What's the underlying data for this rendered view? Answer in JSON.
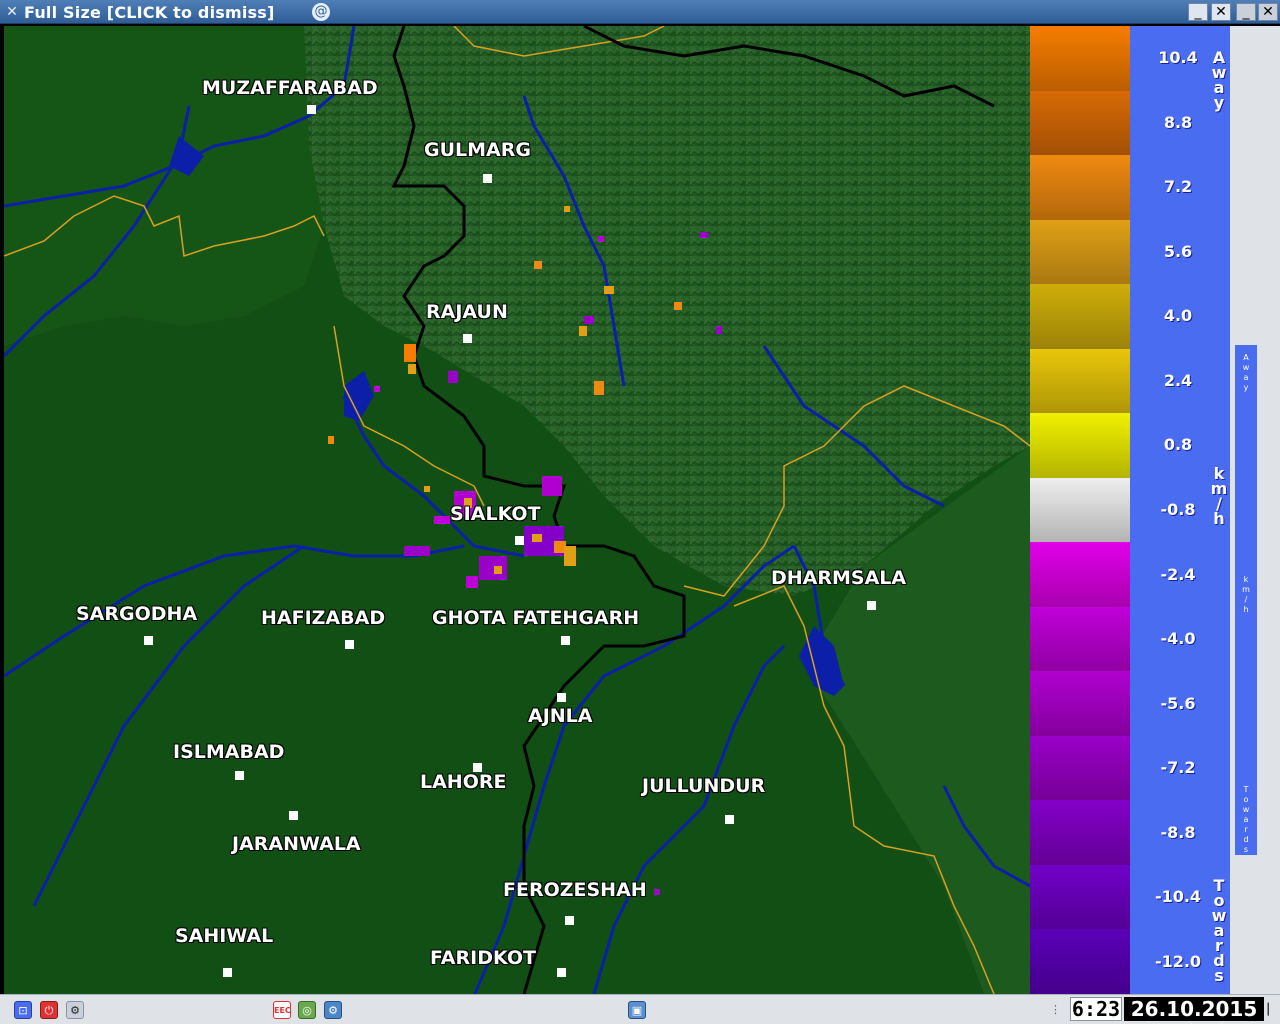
{
  "window": {
    "title": "Full Size  [CLICK to dismiss]",
    "minimize_label": "_",
    "close_label": "✕",
    "outer_close_label": "✕"
  },
  "map": {
    "cities": [
      {
        "name": "MUZAFFARABAD"
      },
      {
        "name": "GULMARG"
      },
      {
        "name": "RAJAUN"
      },
      {
        "name": "SIALKOT"
      },
      {
        "name": "SARGODHA"
      },
      {
        "name": "HAFIZABAD"
      },
      {
        "name": "GHOTA FATEHGARH"
      },
      {
        "name": "DHARMSALA"
      },
      {
        "name": "AJNLA"
      },
      {
        "name": "ISLMABAD"
      },
      {
        "name": "LAHORE"
      },
      {
        "name": "JULLUNDUR"
      },
      {
        "name": "JARANWALA"
      },
      {
        "name": "FEROZESHAH"
      },
      {
        "name": "SAHIWAL"
      },
      {
        "name": "FARIDKOT"
      }
    ]
  },
  "legend": {
    "top_label": "Away",
    "bottom_label": "Towards",
    "unit_label": "km/h",
    "values": [
      "10.4",
      "8.8",
      "7.2",
      "5.6",
      "4.0",
      "2.4",
      "0.8",
      "-0.8",
      "-2.4",
      "-4.0",
      "-5.6",
      "-7.2",
      "-8.8",
      "-10.4",
      "-12.0"
    ],
    "colors": [
      "#f77d00",
      "#d86a06",
      "#ef8a10",
      "#e0a016",
      "#cfae0a",
      "#e8c60a",
      "#f0f000",
      "#eeeeee",
      "#e000e8",
      "#c000d8",
      "#b000d0",
      "#9a00c8",
      "#8400c8",
      "#7000c8",
      "#5a00b8"
    ]
  },
  "mini_legend": {
    "label_away": "Away",
    "label_towards": "Towards",
    "unit_label": "km/h"
  },
  "taskbar": {
    "clock": "6:23",
    "date": "26.10.2015"
  }
}
